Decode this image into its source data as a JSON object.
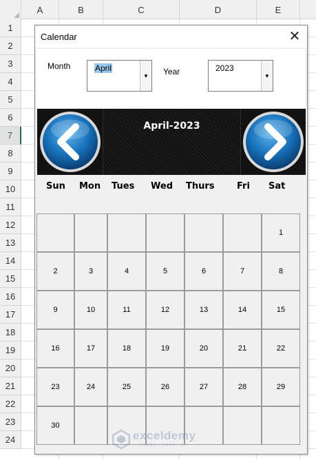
{
  "spreadsheet": {
    "columns": [
      "A",
      "B",
      "C",
      "D",
      "E"
    ],
    "rows": [
      "1",
      "2",
      "3",
      "4",
      "5",
      "6",
      "7",
      "8",
      "9",
      "10",
      "11",
      "12",
      "13",
      "14",
      "15",
      "16",
      "17",
      "18",
      "19",
      "20",
      "21",
      "22",
      "23",
      "24"
    ],
    "active_row": "7"
  },
  "dialog": {
    "title": "Calendar",
    "close_label": "✕",
    "month_label": "Month",
    "month_value": "April",
    "year_label": "Year",
    "year_value": "2023",
    "dropdown_glyph": "▼",
    "header_title": "April-2023",
    "weekdays": [
      "Sun",
      "Mon",
      "Tues",
      "Wed",
      "Thurs",
      "Fri",
      "Sat"
    ],
    "weeks": [
      [
        "",
        "",
        "",
        "",
        "",
        "",
        "1"
      ],
      [
        "2",
        "3",
        "4",
        "5",
        "6",
        "7",
        "8"
      ],
      [
        "9",
        "10",
        "11",
        "12",
        "13",
        "14",
        "15"
      ],
      [
        "16",
        "17",
        "18",
        "19",
        "20",
        "21",
        "22"
      ],
      [
        "23",
        "24",
        "25",
        "26",
        "27",
        "28",
        "29"
      ],
      [
        "30",
        "",
        "",
        "",
        "",
        "",
        ""
      ]
    ]
  },
  "icons": {
    "prev": "chevron-left-icon",
    "next": "chevron-right-icon",
    "accent": "#1670b8"
  },
  "watermark": {
    "name": "exceldemy",
    "tagline": "EXCEL · DATA · BI"
  }
}
